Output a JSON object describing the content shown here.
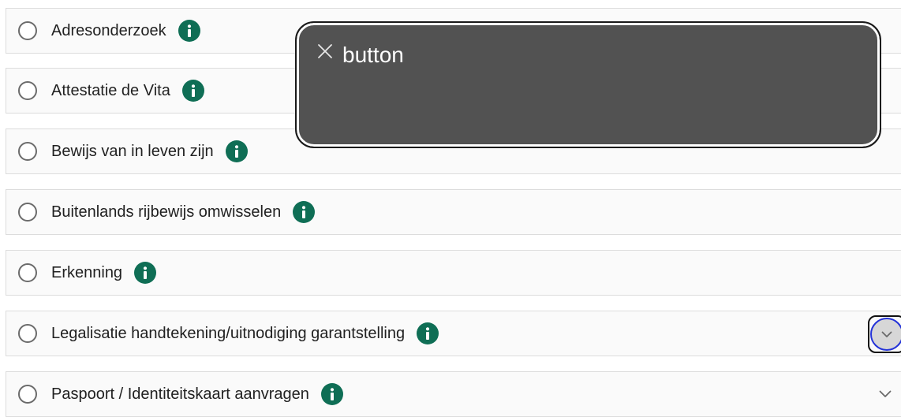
{
  "options": [
    {
      "label": "Adresonderzoek"
    },
    {
      "label": "Attestatie de Vita"
    },
    {
      "label": "Bewijs van in leven zijn"
    },
    {
      "label": "Buitenlands rijbewijs omwisselen"
    },
    {
      "label": "Erkenning"
    },
    {
      "label": "Legalisatie handtekening/uitnodiging garantstelling"
    },
    {
      "label": "Paspoort / Identiteitskaart aanvragen"
    }
  ],
  "tooltip": {
    "text": "button"
  },
  "icons": {
    "info": "info-icon",
    "radio": "radio-icon",
    "chevron": "chevron-down-icon",
    "close": "close-icon"
  },
  "colors": {
    "info_badge": "#0f6e55",
    "tooltip_bg": "#525252",
    "focus_ring": "#2433d8"
  }
}
